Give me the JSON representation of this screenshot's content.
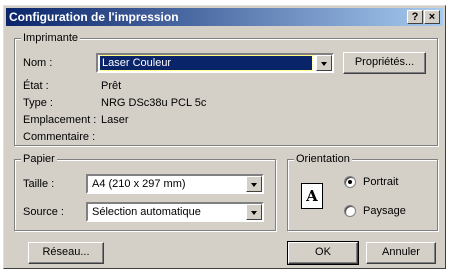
{
  "window": {
    "title": "Configuration de l'impression",
    "help_label": "?",
    "close_label": "×"
  },
  "printer": {
    "group_label": "Imprimante",
    "name_label": "Nom :",
    "name_value": "Laser Couleur",
    "properties_button": "Propriétés...",
    "state_label": "État :",
    "state_value": "Prêt",
    "type_label": "Type :",
    "type_value": "NRG DSc38u PCL 5c",
    "location_label": "Emplacement :",
    "location_value": "Laser",
    "comment_label": "Commentaire :",
    "comment_value": ""
  },
  "paper": {
    "group_label": "Papier",
    "size_label": "Taille :",
    "size_value": "A4 (210 x 297 mm)",
    "source_label": "Source :",
    "source_value": "Sélection automatique"
  },
  "orientation": {
    "group_label": "Orientation",
    "icon_letter": "A",
    "portrait_label": "Portrait",
    "landscape_label": "Paysage",
    "selected": "Portrait"
  },
  "buttons": {
    "network": "Réseau...",
    "ok": "OK",
    "cancel": "Annuler"
  }
}
